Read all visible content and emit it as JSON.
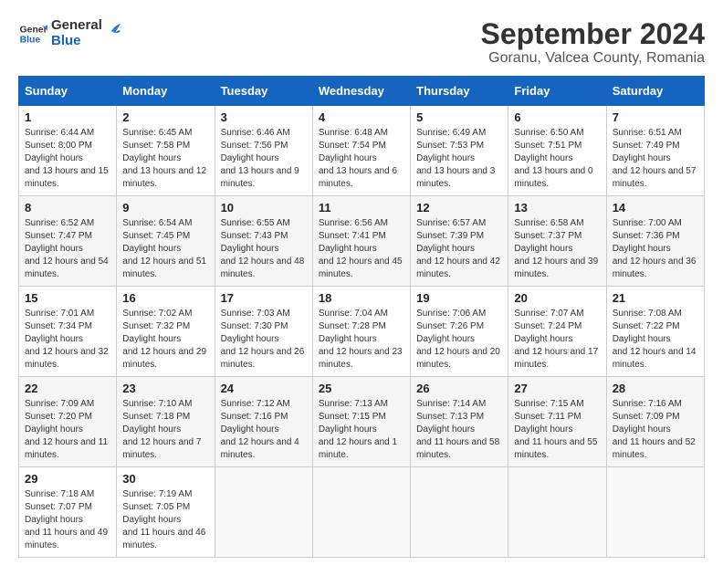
{
  "logo": {
    "text_general": "General",
    "text_blue": "Blue"
  },
  "title": "September 2024",
  "subtitle": "Goranu, Valcea County, Romania",
  "days_of_week": [
    "Sunday",
    "Monday",
    "Tuesday",
    "Wednesday",
    "Thursday",
    "Friday",
    "Saturday"
  ],
  "weeks": [
    [
      {
        "day": "1",
        "sunrise": "6:44 AM",
        "sunset": "8:00 PM",
        "daylight": "13 hours and 15 minutes."
      },
      {
        "day": "2",
        "sunrise": "6:45 AM",
        "sunset": "7:58 PM",
        "daylight": "13 hours and 12 minutes."
      },
      {
        "day": "3",
        "sunrise": "6:46 AM",
        "sunset": "7:56 PM",
        "daylight": "13 hours and 9 minutes."
      },
      {
        "day": "4",
        "sunrise": "6:48 AM",
        "sunset": "7:54 PM",
        "daylight": "13 hours and 6 minutes."
      },
      {
        "day": "5",
        "sunrise": "6:49 AM",
        "sunset": "7:53 PM",
        "daylight": "13 hours and 3 minutes."
      },
      {
        "day": "6",
        "sunrise": "6:50 AM",
        "sunset": "7:51 PM",
        "daylight": "13 hours and 0 minutes."
      },
      {
        "day": "7",
        "sunrise": "6:51 AM",
        "sunset": "7:49 PM",
        "daylight": "12 hours and 57 minutes."
      }
    ],
    [
      {
        "day": "8",
        "sunrise": "6:52 AM",
        "sunset": "7:47 PM",
        "daylight": "12 hours and 54 minutes."
      },
      {
        "day": "9",
        "sunrise": "6:54 AM",
        "sunset": "7:45 PM",
        "daylight": "12 hours and 51 minutes."
      },
      {
        "day": "10",
        "sunrise": "6:55 AM",
        "sunset": "7:43 PM",
        "daylight": "12 hours and 48 minutes."
      },
      {
        "day": "11",
        "sunrise": "6:56 AM",
        "sunset": "7:41 PM",
        "daylight": "12 hours and 45 minutes."
      },
      {
        "day": "12",
        "sunrise": "6:57 AM",
        "sunset": "7:39 PM",
        "daylight": "12 hours and 42 minutes."
      },
      {
        "day": "13",
        "sunrise": "6:58 AM",
        "sunset": "7:37 PM",
        "daylight": "12 hours and 39 minutes."
      },
      {
        "day": "14",
        "sunrise": "7:00 AM",
        "sunset": "7:36 PM",
        "daylight": "12 hours and 36 minutes."
      }
    ],
    [
      {
        "day": "15",
        "sunrise": "7:01 AM",
        "sunset": "7:34 PM",
        "daylight": "12 hours and 32 minutes."
      },
      {
        "day": "16",
        "sunrise": "7:02 AM",
        "sunset": "7:32 PM",
        "daylight": "12 hours and 29 minutes."
      },
      {
        "day": "17",
        "sunrise": "7:03 AM",
        "sunset": "7:30 PM",
        "daylight": "12 hours and 26 minutes."
      },
      {
        "day": "18",
        "sunrise": "7:04 AM",
        "sunset": "7:28 PM",
        "daylight": "12 hours and 23 minutes."
      },
      {
        "day": "19",
        "sunrise": "7:06 AM",
        "sunset": "7:26 PM",
        "daylight": "12 hours and 20 minutes."
      },
      {
        "day": "20",
        "sunrise": "7:07 AM",
        "sunset": "7:24 PM",
        "daylight": "12 hours and 17 minutes."
      },
      {
        "day": "21",
        "sunrise": "7:08 AM",
        "sunset": "7:22 PM",
        "daylight": "12 hours and 14 minutes."
      }
    ],
    [
      {
        "day": "22",
        "sunrise": "7:09 AM",
        "sunset": "7:20 PM",
        "daylight": "12 hours and 11 minutes."
      },
      {
        "day": "23",
        "sunrise": "7:10 AM",
        "sunset": "7:18 PM",
        "daylight": "12 hours and 7 minutes."
      },
      {
        "day": "24",
        "sunrise": "7:12 AM",
        "sunset": "7:16 PM",
        "daylight": "12 hours and 4 minutes."
      },
      {
        "day": "25",
        "sunrise": "7:13 AM",
        "sunset": "7:15 PM",
        "daylight": "12 hours and 1 minute."
      },
      {
        "day": "26",
        "sunrise": "7:14 AM",
        "sunset": "7:13 PM",
        "daylight": "11 hours and 58 minutes."
      },
      {
        "day": "27",
        "sunrise": "7:15 AM",
        "sunset": "7:11 PM",
        "daylight": "11 hours and 55 minutes."
      },
      {
        "day": "28",
        "sunrise": "7:16 AM",
        "sunset": "7:09 PM",
        "daylight": "11 hours and 52 minutes."
      }
    ],
    [
      {
        "day": "29",
        "sunrise": "7:18 AM",
        "sunset": "7:07 PM",
        "daylight": "11 hours and 49 minutes."
      },
      {
        "day": "30",
        "sunrise": "7:19 AM",
        "sunset": "7:05 PM",
        "daylight": "11 hours and 46 minutes."
      },
      null,
      null,
      null,
      null,
      null
    ]
  ]
}
